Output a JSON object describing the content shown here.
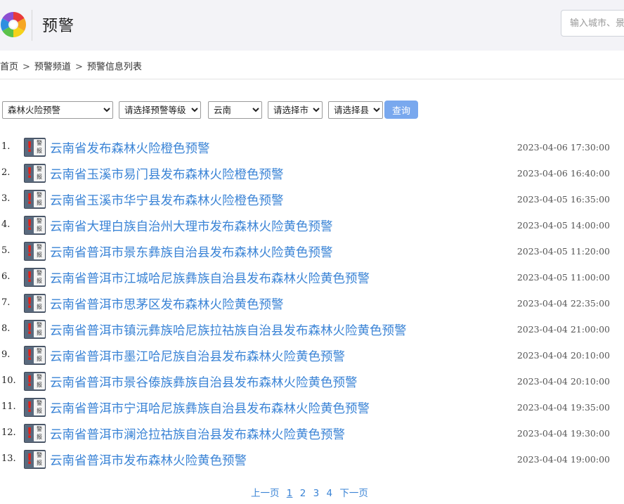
{
  "header": {
    "title": "预警",
    "search_placeholder": "输入城市、景点名称"
  },
  "breadcrumb": {
    "items": [
      "首页",
      "预警频道",
      "预警信息列表"
    ],
    "separator": ">"
  },
  "filters": {
    "type": "森林火险预警",
    "level": "请选择预警等级",
    "province": "云南",
    "city": "请选择市",
    "county": "请选择县",
    "query_label": "查询"
  },
  "icon": {
    "panel_text_top": "警",
    "panel_text_bottom": "报"
  },
  "alerts": [
    {
      "index": "1.",
      "title": "云南省发布森林火险橙色预警",
      "time": "2023-04-06 17:30:00"
    },
    {
      "index": "2.",
      "title": "云南省玉溪市易门县发布森林火险橙色预警",
      "time": "2023-04-06 16:40:00"
    },
    {
      "index": "3.",
      "title": "云南省玉溪市华宁县发布森林火险橙色预警",
      "time": "2023-04-05 16:35:00"
    },
    {
      "index": "4.",
      "title": "云南省大理白族自治州大理市发布森林火险黄色预警",
      "time": "2023-04-05 14:00:00"
    },
    {
      "index": "5.",
      "title": "云南省普洱市景东彝族自治县发布森林火险黄色预警",
      "time": "2023-04-05 11:20:00"
    },
    {
      "index": "6.",
      "title": "云南省普洱市江城哈尼族彝族自治县发布森林火险黄色预警",
      "time": "2023-04-05 11:00:00"
    },
    {
      "index": "7.",
      "title": "云南省普洱市思茅区发布森林火险黄色预警",
      "time": "2023-04-04 22:35:00"
    },
    {
      "index": "8.",
      "title": "云南省普洱市镇沅彝族哈尼族拉祜族自治县发布森林火险黄色预警",
      "time": "2023-04-04 21:00:00"
    },
    {
      "index": "9.",
      "title": "云南省普洱市墨江哈尼族自治县发布森林火险黄色预警",
      "time": "2023-04-04 20:10:00"
    },
    {
      "index": "10.",
      "title": "云南省普洱市景谷傣族彝族自治县发布森林火险黄色预警",
      "time": "2023-04-04 20:10:00"
    },
    {
      "index": "11.",
      "title": "云南省普洱市宁洱哈尼族彝族自治县发布森林火险黄色预警",
      "time": "2023-04-04 19:35:00"
    },
    {
      "index": "12.",
      "title": "云南省普洱市澜沧拉祜族自治县发布森林火险黄色预警",
      "time": "2023-04-04 19:30:00"
    },
    {
      "index": "13.",
      "title": "云南省普洱市发布森林火险黄色预警",
      "time": "2023-04-04 19:00:00"
    }
  ],
  "pager": {
    "prev": "上一页",
    "pages": [
      "1",
      "2",
      "3",
      "4"
    ],
    "current": "1",
    "next": "下一页"
  },
  "colors": {
    "link": "#3b84d6",
    "header_bg": "#f3f3f7",
    "query_button": "#79a8ee",
    "alert_mark": "#e2231a"
  }
}
